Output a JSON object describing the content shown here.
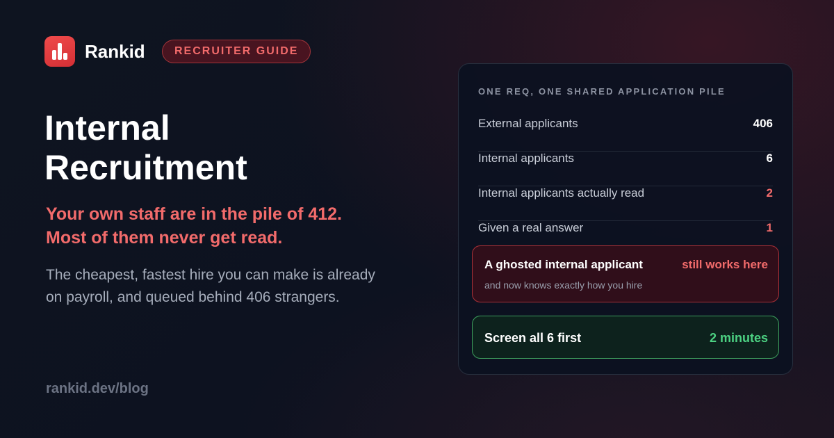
{
  "header": {
    "brand": "Rankid",
    "badge": "RECRUITER GUIDE",
    "logo_icon": "bar-chart-icon"
  },
  "main": {
    "title_line1": "Internal",
    "title_line2": "Recruitment",
    "tagline_line1": "Your own staff are in the pile of 412.",
    "tagline_line2": "Most of them never get read.",
    "description_line1": "The cheapest, fastest hire you can make is already",
    "description_line2": "on payroll, and queued behind 406 strangers."
  },
  "card": {
    "heading": "ONE REQ, ONE SHARED APPLICATION PILE",
    "rows": [
      {
        "label": "External applicants",
        "value": "406"
      },
      {
        "label": "Internal applicants",
        "value": "6"
      },
      {
        "label": "Internal applicants actually read",
        "value": "2"
      },
      {
        "label": "Given a real answer",
        "value": "1"
      }
    ],
    "alert": {
      "title": "A ghosted internal applicant",
      "tag": "still works here",
      "subtitle": "and now knows exactly how you hire"
    },
    "cta": {
      "label": "Screen all 6 first",
      "time": "2 minutes"
    }
  },
  "footer": {
    "link": "rankid.dev/blog"
  },
  "colors": {
    "accent_red": "#f26b6b",
    "brand_red": "#e33b3f",
    "accent_green": "#4cd182",
    "background": "#0e1420"
  }
}
